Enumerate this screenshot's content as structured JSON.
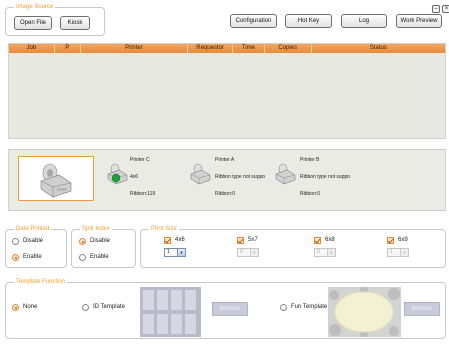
{
  "image_source": {
    "legend": "Image Source",
    "open_file": "Open File",
    "kiosk": "Kiosk"
  },
  "toolbar": {
    "configuration": "Configuration",
    "hot_key": "Hot Key",
    "log": "Log",
    "work_preview": "Work Preview"
  },
  "window": {
    "minimize": "–",
    "close": "×"
  },
  "table": {
    "columns": [
      "Job",
      "P",
      "Printer",
      "Requestor",
      "Time",
      "Copies",
      "Status"
    ],
    "header_color": "#ec9447"
  },
  "printers": [
    {
      "name": "Printer C",
      "status": "4x6",
      "ribbon": "Ribbon:119"
    },
    {
      "name": "Printer A",
      "status": "Ribbon type not suppo",
      "ribbon": "Ribbon:0"
    },
    {
      "name": "Printer B",
      "status": "Ribbon type not suppo",
      "ribbon": "Ribbon:0"
    }
  ],
  "date_printed": {
    "legend": "Date Printed",
    "disable": "Disable",
    "enable": "Enable",
    "selected": "Enable"
  },
  "split_index": {
    "legend": "Split Index",
    "disable": "Disable",
    "enable": "Enable",
    "selected": "Disable"
  },
  "print_size": {
    "legend": "Print Size",
    "sizes": [
      {
        "label": "4x6",
        "qty": "1",
        "enabled": true
      },
      {
        "label": "5x7",
        "qty": "0",
        "enabled": false
      },
      {
        "label": "6x8",
        "qty": "0",
        "enabled": false
      },
      {
        "label": "6x9",
        "qty": "1",
        "enabled": false
      }
    ]
  },
  "template_function": {
    "legend": "Template Function",
    "none": "None",
    "id_template": "ID Template",
    "fun_template": "Fun Template",
    "browse": "Browse",
    "selected": "None"
  },
  "colors": {
    "accent": "#f09a3e",
    "panel": "#e8e8e2"
  }
}
